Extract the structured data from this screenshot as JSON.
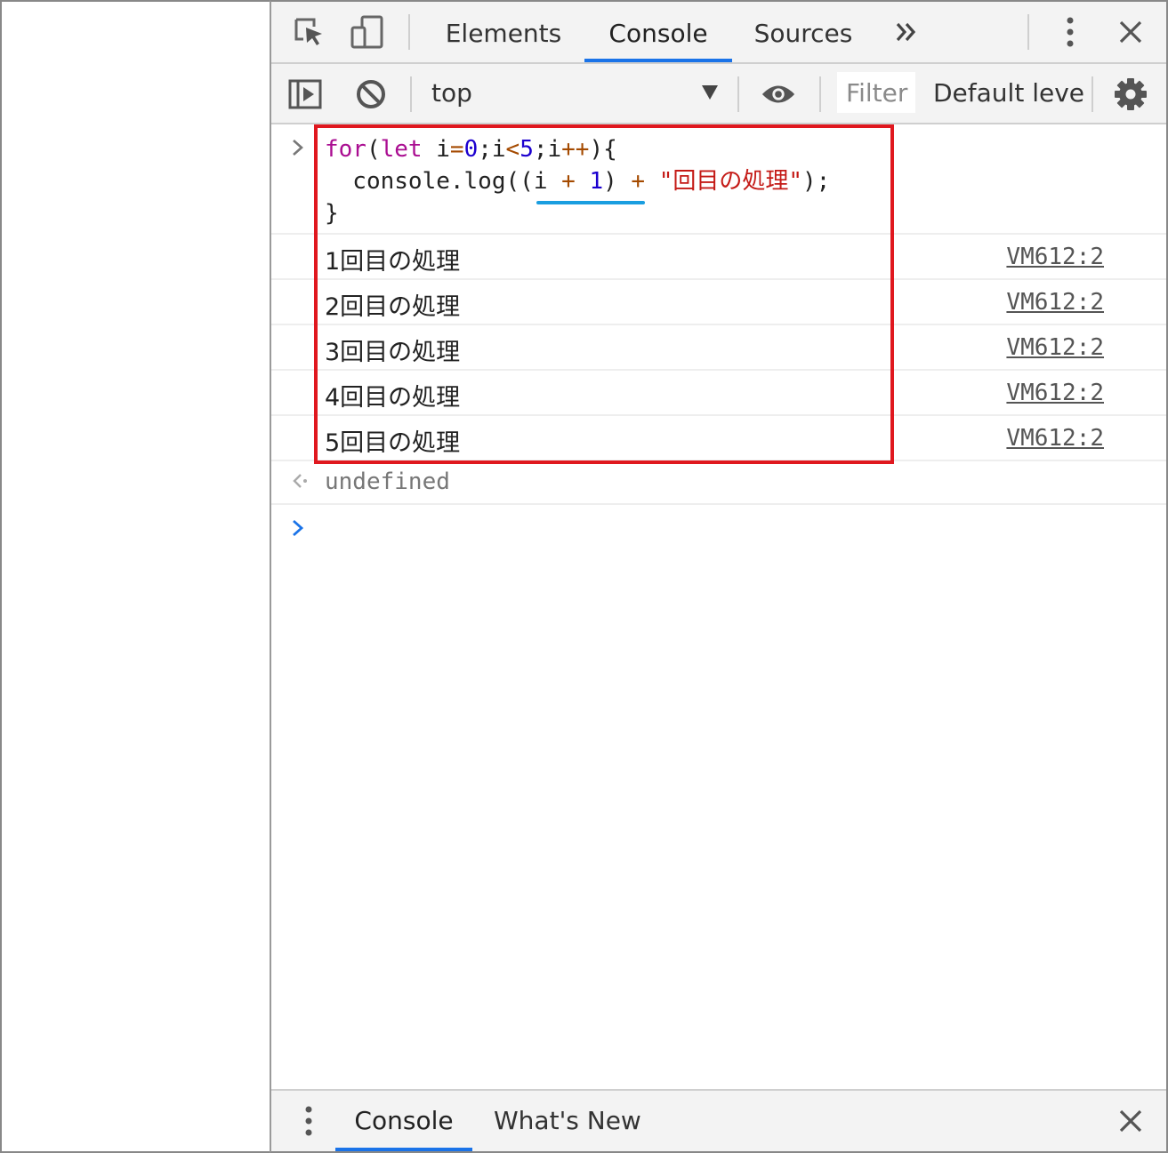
{
  "tabs": {
    "items": [
      "Elements",
      "Console",
      "Sources"
    ],
    "active": "Console",
    "overflow_icon": "chevron-double-right-icon",
    "menu_icon": "kebab-menu-icon",
    "close_icon": "close-icon"
  },
  "toolbar": {
    "context": "top",
    "filter_placeholder": "Filter",
    "levels": "Default leve"
  },
  "console": {
    "input_lines": [
      {
        "parts": [
          [
            "kw",
            "for"
          ],
          [
            "plain",
            "("
          ],
          [
            "kw",
            "let"
          ],
          [
            "plain",
            " "
          ],
          [
            "plain",
            "i"
          ],
          [
            "op",
            "="
          ],
          [
            "num",
            "0"
          ],
          [
            "plain",
            ";i"
          ],
          [
            "op",
            "<"
          ],
          [
            "num",
            "5"
          ],
          [
            "plain",
            ";i"
          ],
          [
            "op",
            "++"
          ],
          [
            "plain",
            "){"
          ]
        ]
      },
      {
        "parts": [
          [
            "plain",
            "  console.log(("
          ],
          [
            "plain",
            "i "
          ],
          [
            "op",
            "+"
          ],
          [
            "plain",
            " "
          ],
          [
            "num",
            "1"
          ],
          [
            "plain",
            ") "
          ],
          [
            "op",
            "+"
          ],
          [
            "plain",
            " "
          ],
          [
            "str",
            "\"回目の処理\""
          ],
          [
            "plain",
            ");"
          ]
        ]
      },
      {
        "parts": [
          [
            "plain",
            "}"
          ]
        ]
      }
    ],
    "logs": [
      {
        "text": "1回目の処理",
        "source": "VM612:2"
      },
      {
        "text": "2回目の処理",
        "source": "VM612:2"
      },
      {
        "text": "3回目の処理",
        "source": "VM612:2"
      },
      {
        "text": "4回目の処理",
        "source": "VM612:2"
      },
      {
        "text": "5回目の処理",
        "source": "VM612:2"
      }
    ],
    "result": "undefined"
  },
  "drawer": {
    "tabs": [
      "Console",
      "What's New"
    ],
    "active": "Console"
  },
  "colors": {
    "accent": "#1a73e8",
    "highlight_box": "#e0181f",
    "keyword": "#aa0d91",
    "number": "#1c00cf",
    "string": "#c41a16"
  }
}
